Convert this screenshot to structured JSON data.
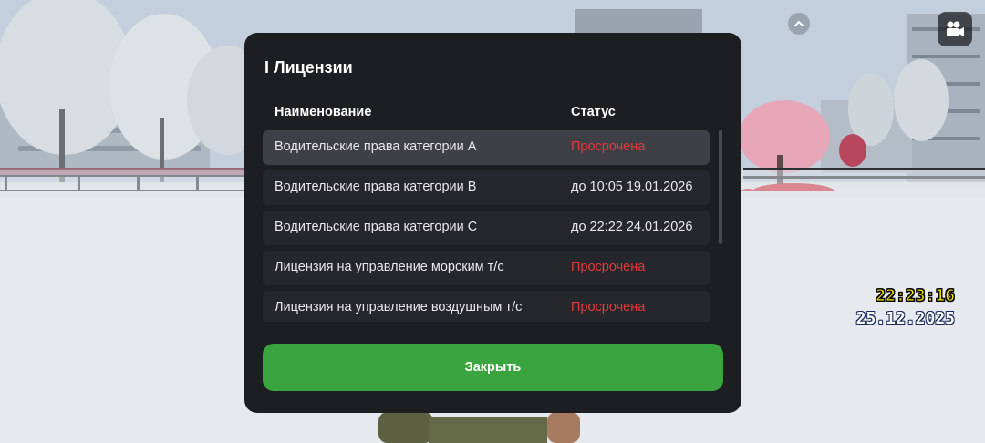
{
  "hud": {
    "time": "22:23:16",
    "date": "25.12.2025"
  },
  "icons": {
    "camera": "camera-icon",
    "collapse": "chevron-up-icon"
  },
  "dialog": {
    "title": "I Лицензии",
    "columns": {
      "name": "Наименование",
      "status": "Статус"
    },
    "rows": [
      {
        "name": "Водительские права категории A",
        "status": "Просрочена",
        "expired": true
      },
      {
        "name": "Водительские права категории B",
        "status": "до 10:05 19.01.2026",
        "expired": false
      },
      {
        "name": "Водительские права категории C",
        "status": "до 22:22 24.01.2026",
        "expired": false
      },
      {
        "name": "Лицензия на управление морским т/с",
        "status": "Просрочена",
        "expired": true
      },
      {
        "name": "Лицензия на управление воздушным т/с",
        "status": "Просрочена",
        "expired": true
      }
    ],
    "close_label": "Закрыть"
  },
  "colors": {
    "expired": "#e53a3a",
    "close_button": "#3aa53f",
    "modal_bg": "#1d1e22",
    "hud_time": "#f7e300"
  }
}
